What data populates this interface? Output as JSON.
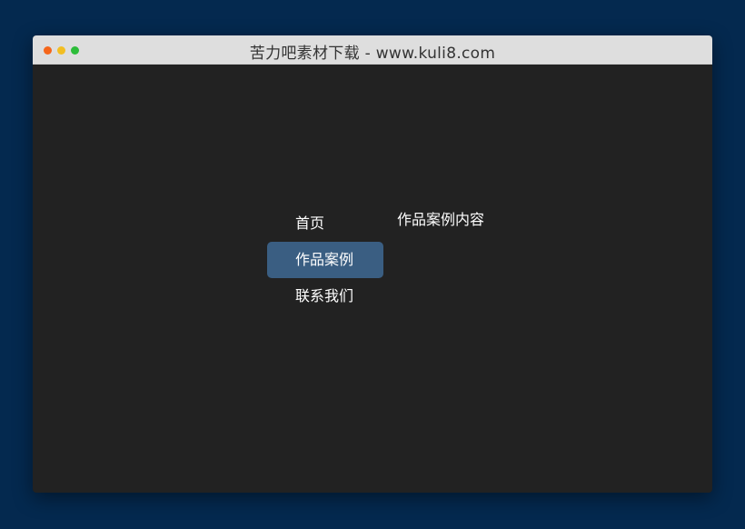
{
  "window": {
    "title": "苦力吧素材下载 - www.kuli8.com",
    "controls": [
      "close",
      "minimize",
      "maximize"
    ]
  },
  "nav": {
    "items": [
      {
        "label": "首页",
        "active": false
      },
      {
        "label": "作品案例",
        "active": true
      },
      {
        "label": "联系我们",
        "active": false
      }
    ]
  },
  "panel": {
    "text": "作品案例内容"
  },
  "colors": {
    "page_background": "#04294f",
    "window_background": "#222222",
    "titlebar": "#dedede",
    "active_item": "#3a5e82",
    "close_dot": "#f5661b",
    "minimize_dot": "#f2be23",
    "maximize_dot": "#2dbd3a"
  }
}
